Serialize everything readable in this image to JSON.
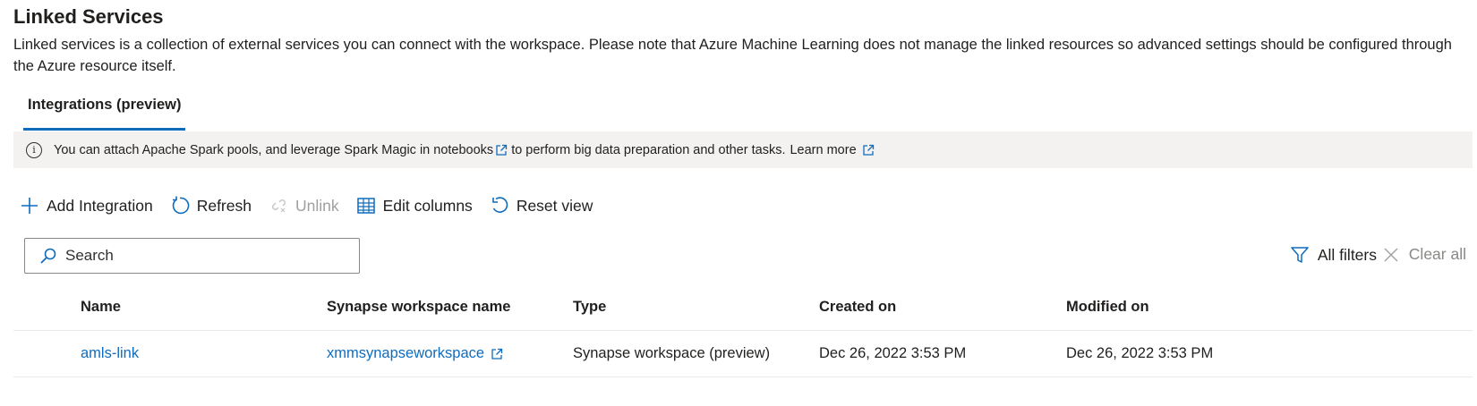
{
  "page": {
    "title": "Linked Services",
    "description": "Linked services is a collection of external services you can connect with the workspace. Please note that Azure Machine Learning does not manage the linked resources so advanced settings should be configured through the Azure resource itself."
  },
  "tabs": [
    {
      "label": "Integrations (preview)",
      "selected": true
    }
  ],
  "info_bar": {
    "text_before": "You can attach Apache Spark pools, and leverage Spark Magic in notebooks",
    "text_middle": "to perform big data preparation and other tasks.",
    "learn_more": "Learn more"
  },
  "toolbar": {
    "add": "Add Integration",
    "refresh": "Refresh",
    "unlink": "Unlink",
    "edit_columns": "Edit columns",
    "reset_view": "Reset view"
  },
  "search": {
    "placeholder": "Search"
  },
  "filters": {
    "all_filters": "All filters",
    "clear_all": "Clear all"
  },
  "table": {
    "columns": [
      "Name",
      "Synapse workspace name",
      "Type",
      "Created on",
      "Modified on"
    ],
    "rows": [
      {
        "name": "amls-link",
        "workspace": "xmmsynapseworkspace",
        "type": "Synapse workspace (preview)",
        "created": "Dec 26, 2022 3:53 PM",
        "modified": "Dec 26, 2022 3:53 PM"
      }
    ]
  },
  "colors": {
    "accent": "#0f6cbd",
    "infobar_bg": "#f3f2f1",
    "disabled": "#a19f9d"
  }
}
